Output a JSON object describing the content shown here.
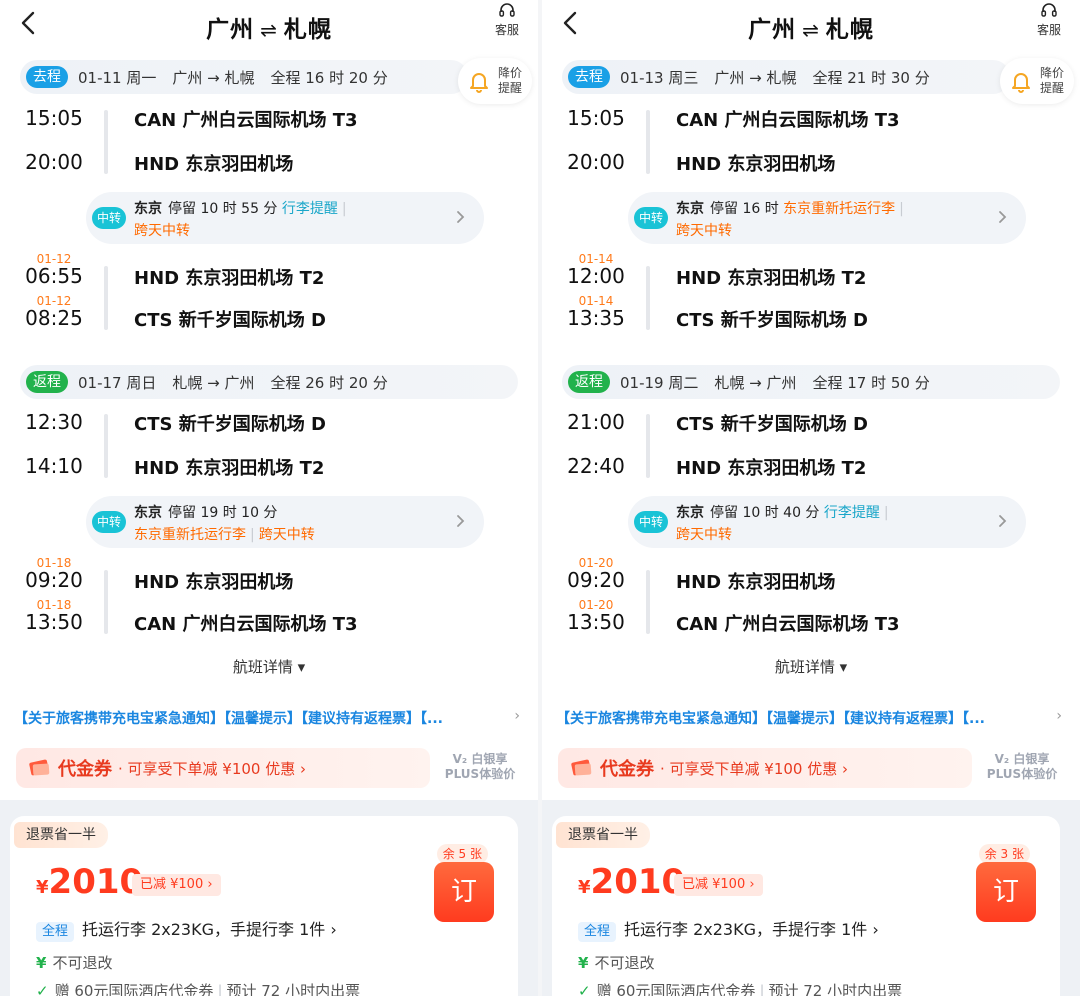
{
  "panels": [
    {
      "title_from": "广州",
      "title_swap": "⇌",
      "title_to": "札幌",
      "cs_label": "客服",
      "remind_line1": "降价",
      "remind_line2": "提醒",
      "out": {
        "tag": "去程",
        "date": "01-11 周一",
        "route": "广州 → 札幌",
        "duration": "全程 16 时 20 分",
        "seg1": {
          "dep_time": "15:05",
          "dep_airport": "CAN 广州白云国际机场 T3",
          "arr_time": "20:00",
          "arr_airport": "HND 东京羽田机场"
        },
        "transfer": {
          "tag": "中转",
          "city": "东京",
          "stay": "停留 10 时 55 分",
          "note1": "行李提醒",
          "note2": "跨天中转"
        },
        "seg2": {
          "dep_date": "01-12",
          "dep_time": "06:55",
          "dep_airport": "HND 东京羽田机场 T2",
          "arr_date": "01-12",
          "arr_time": "08:25",
          "arr_airport": "CTS 新千岁国际机场 D"
        }
      },
      "ret": {
        "tag": "返程",
        "date": "01-17 周日",
        "route": "札幌 → 广州",
        "duration": "全程 26 时 20 分",
        "seg1": {
          "dep_time": "12:30",
          "dep_airport": "CTS 新千岁国际机场 D",
          "arr_time": "14:10",
          "arr_airport": "HND 东京羽田机场 T2"
        },
        "transfer": {
          "tag": "中转",
          "city": "东京",
          "stay": "停留 19 时 10 分",
          "note1": "东京重新托运行李",
          "note2": "跨天中转"
        },
        "seg2": {
          "dep_date": "01-18",
          "dep_time": "09:20",
          "dep_airport": "HND 东京羽田机场",
          "arr_date": "01-18",
          "arr_time": "13:50",
          "arr_airport": "CAN 广州白云国际机场 T3"
        }
      },
      "detail_label": "航班详情 ▾",
      "notice": "【关于旅客携带充电宝紧急通知】【温馨提示】【建议持有返程票】【...",
      "coupon_name": "代金券",
      "coupon_desc": "· 可享受下单减 ¥100 优惠 ›",
      "plus_line1": "V₂ 白银享",
      "plus_line2": "PLUS体验价",
      "refund_tag": "退票省一半",
      "currency": "¥",
      "price": "2010",
      "reduce": "已减 ¥100 ›",
      "seats": "余 5 张",
      "book": "订",
      "full_tag": "全程",
      "baggage": "托运行李 2x23KG，手提行李 1件 ›",
      "rule": "不可退改",
      "gift": "赠 60元国际酒店代金券",
      "ticketing": "预计 72 小时内出票"
    },
    {
      "title_from": "广州",
      "title_swap": "⇌",
      "title_to": "札幌",
      "cs_label": "客服",
      "remind_line1": "降价",
      "remind_line2": "提醒",
      "out": {
        "tag": "去程",
        "date": "01-13 周三",
        "route": "广州 → 札幌",
        "duration": "全程 21 时 30 分",
        "seg1": {
          "dep_time": "15:05",
          "dep_airport": "CAN 广州白云国际机场 T3",
          "arr_time": "20:00",
          "arr_airport": "HND 东京羽田机场"
        },
        "transfer": {
          "tag": "中转",
          "city": "东京",
          "stay": "停留 16 时",
          "note1": "东京重新托运行李",
          "note2": "跨天中转"
        },
        "seg2": {
          "dep_date": "01-14",
          "dep_time": "12:00",
          "dep_airport": "HND 东京羽田机场 T2",
          "arr_date": "01-14",
          "arr_time": "13:35",
          "arr_airport": "CTS 新千岁国际机场 D"
        }
      },
      "ret": {
        "tag": "返程",
        "date": "01-19 周二",
        "route": "札幌 → 广州",
        "duration": "全程 17 时 50 分",
        "seg1": {
          "dep_time": "21:00",
          "dep_airport": "CTS 新千岁国际机场 D",
          "arr_time": "22:40",
          "arr_airport": "HND 东京羽田机场 T2"
        },
        "transfer": {
          "tag": "中转",
          "city": "东京",
          "stay": "停留 10 时 40 分",
          "note1": "行李提醒",
          "note2": "跨天中转"
        },
        "seg2": {
          "dep_date": "01-20",
          "dep_time": "09:20",
          "dep_airport": "HND 东京羽田机场",
          "arr_date": "01-20",
          "arr_time": "13:50",
          "arr_airport": "CAN 广州白云国际机场 T3"
        }
      },
      "detail_label": "航班详情 ▾",
      "notice": "【关于旅客携带充电宝紧急通知】【温馨提示】【建议持有返程票】【...",
      "coupon_name": "代金券",
      "coupon_desc": "· 可享受下单减 ¥100 优惠 ›",
      "plus_line1": "V₂ 白银享",
      "plus_line2": "PLUS体验价",
      "refund_tag": "退票省一半",
      "currency": "¥",
      "price": "2010",
      "reduce": "已减 ¥100 ›",
      "seats": "余 3 张",
      "book": "订",
      "full_tag": "全程",
      "baggage": "托运行李 2x23KG，手提行李 1件 ›",
      "rule": "不可退改",
      "gift": "赠 60元国际酒店代金券",
      "ticketing": "预计 72 小时内出票"
    }
  ]
}
